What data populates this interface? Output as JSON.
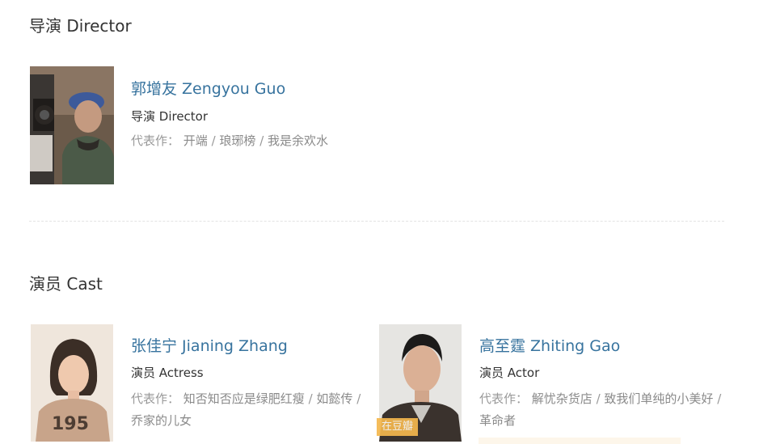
{
  "director_section": {
    "title": "导演 Director",
    "person": {
      "name": "郭增友 Zengyou Guo",
      "role": "导演 Director",
      "works_label": "代表作：",
      "works": [
        "开端",
        "琅琊榜",
        "我是余欢水"
      ]
    }
  },
  "cast_section": {
    "title": "演员 Cast",
    "people": [
      {
        "name": "张佳宁 Jianing Zhang",
        "role": "演员 Actress",
        "works_label": "代表作：",
        "works": [
          "知否知否应是绿肥红瘦",
          "如懿传",
          "乔家的儿女"
        ]
      },
      {
        "name": "高至霆 Zhiting Gao",
        "role": "演员 Actor",
        "works_label": "代表作：",
        "works": [
          "解忧杂货店",
          "致我们单纯的小美好",
          "革命者"
        ],
        "badge": "在豆瓣"
      }
    ]
  },
  "colors": {
    "name_link": "#37739e",
    "works_text": "#8a8a8a",
    "badge_bg": "#f5b84e"
  }
}
